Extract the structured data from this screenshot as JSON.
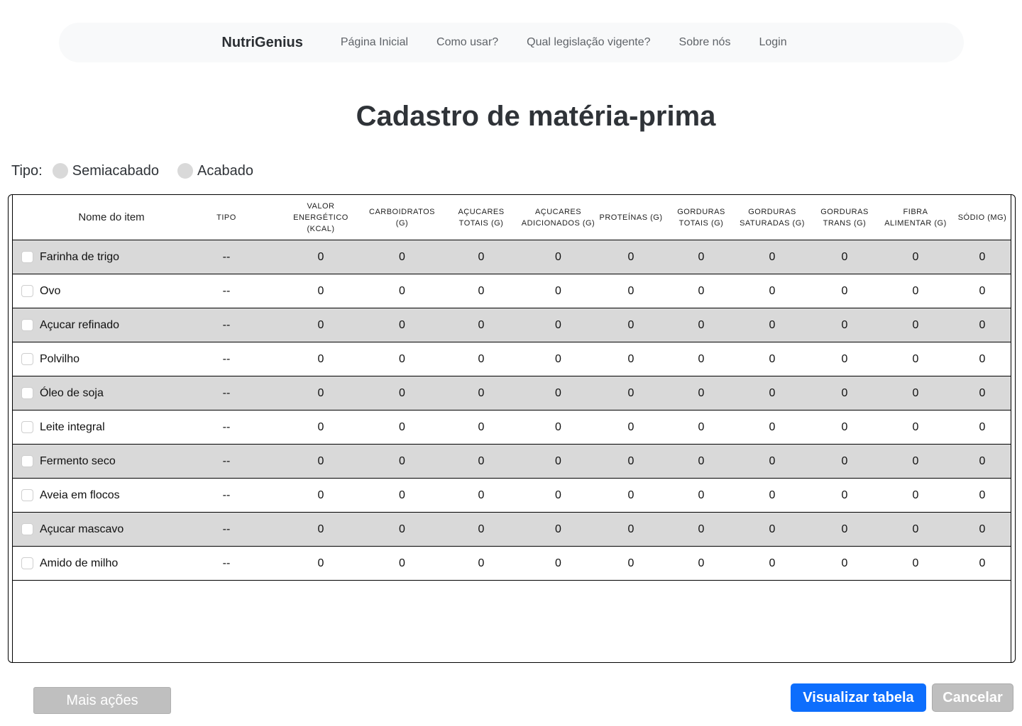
{
  "nav": {
    "brand": "NutriGenius",
    "links": [
      "Página Inicial",
      "Como usar?",
      "Qual legislação vigente?",
      "Sobre nós",
      "Login"
    ]
  },
  "page_title": "Cadastro de matéria-prima",
  "tipo": {
    "label": "Tipo:",
    "options": [
      "Semiacabado",
      "Acabado"
    ]
  },
  "table": {
    "headers": [
      "Nome do item",
      "TIPO",
      "VALOR ENERGÉTICO (KCAL)",
      "CARBOIDRATOS (G)",
      "AÇUCARES TOTAIS (G)",
      "AÇUCARES ADICIONADOS (G)",
      "PROTEÍNAS (G)",
      "GORDURAS TOTAIS (G)",
      "GORDURAS SATURADAS (G)",
      "GORDURAS TRANS (G)",
      "FIBRA ALIMENTAR (G)",
      "SÓDIO (MG)"
    ],
    "rows": [
      {
        "name": "Farinha de trigo",
        "tipo": "--",
        "values": [
          "0",
          "0",
          "0",
          "0",
          "0",
          "0",
          "0",
          "0",
          "0",
          "0"
        ]
      },
      {
        "name": "Ovo",
        "tipo": "--",
        "values": [
          "0",
          "0",
          "0",
          "0",
          "0",
          "0",
          "0",
          "0",
          "0",
          "0"
        ]
      },
      {
        "name": "Açucar refinado",
        "tipo": "--",
        "values": [
          "0",
          "0",
          "0",
          "0",
          "0",
          "0",
          "0",
          "0",
          "0",
          "0"
        ]
      },
      {
        "name": "Polvilho",
        "tipo": "--",
        "values": [
          "0",
          "0",
          "0",
          "0",
          "0",
          "0",
          "0",
          "0",
          "0",
          "0"
        ]
      },
      {
        "name": "Óleo de soja",
        "tipo": "--",
        "values": [
          "0",
          "0",
          "0",
          "0",
          "0",
          "0",
          "0",
          "0",
          "0",
          "0"
        ]
      },
      {
        "name": "Leite integral",
        "tipo": "--",
        "values": [
          "0",
          "0",
          "0",
          "0",
          "0",
          "0",
          "0",
          "0",
          "0",
          "0"
        ]
      },
      {
        "name": "Fermento seco",
        "tipo": "--",
        "values": [
          "0",
          "0",
          "0",
          "0",
          "0",
          "0",
          "0",
          "0",
          "0",
          "0"
        ]
      },
      {
        "name": "Aveia em flocos",
        "tipo": "--",
        "values": [
          "0",
          "0",
          "0",
          "0",
          "0",
          "0",
          "0",
          "0",
          "0",
          "0"
        ]
      },
      {
        "name": "Açucar mascavo",
        "tipo": "--",
        "values": [
          "0",
          "0",
          "0",
          "0",
          "0",
          "0",
          "0",
          "0",
          "0",
          "0"
        ]
      },
      {
        "name": "Amido de milho",
        "tipo": "--",
        "values": [
          "0",
          "0",
          "0",
          "0",
          "0",
          "0",
          "0",
          "0",
          "0",
          "0"
        ]
      }
    ]
  },
  "buttons": {
    "more_actions": "Mais ações",
    "view_table": "Visualizar tabela",
    "cancel": "Cancelar"
  },
  "colors": {
    "primary": "#0d6efd",
    "row_shade": "#d9d9d9",
    "disabled": "#bfbfbf"
  }
}
